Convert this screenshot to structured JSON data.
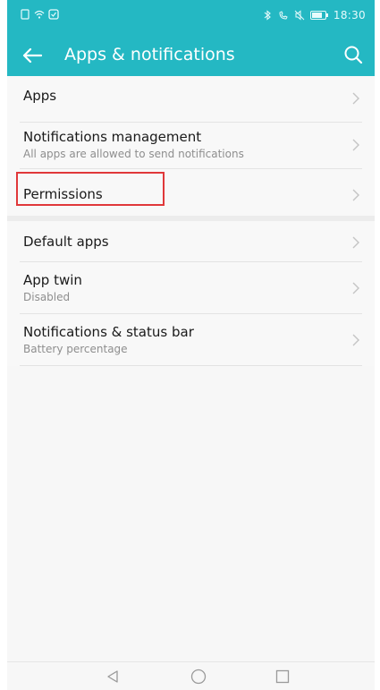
{
  "status_bar": {
    "time": "18:30",
    "left_icons": [
      "sim-icon",
      "wifi-icon",
      "notification-icon"
    ],
    "right_icons": [
      "bluetooth-icon",
      "phone-icon",
      "mute-icon",
      "battery-icon"
    ]
  },
  "app_bar": {
    "title": "Apps & notifications",
    "back_icon": "back-arrow-icon",
    "search_icon": "search-icon"
  },
  "list_groups": [
    {
      "items": [
        {
          "title": "Apps",
          "subtitle": ""
        },
        {
          "title": "Notifications management",
          "subtitle": "All apps are allowed to send notifications"
        },
        {
          "title": "Permissions",
          "subtitle": "",
          "highlighted": true
        }
      ]
    },
    {
      "items": [
        {
          "title": "Default apps",
          "subtitle": ""
        },
        {
          "title": "App twin",
          "subtitle": "Disabled"
        },
        {
          "title": "Notifications & status bar",
          "subtitle": "Battery percentage"
        }
      ]
    }
  ],
  "nav_bar": {
    "icons": [
      "back-triangle-icon",
      "home-circle-icon",
      "recents-square-icon"
    ]
  },
  "colors": {
    "accent": "#24b8c3",
    "highlight": "#e0383a",
    "text_primary": "#1a1a1a",
    "text_secondary": "#8e8e8e"
  }
}
